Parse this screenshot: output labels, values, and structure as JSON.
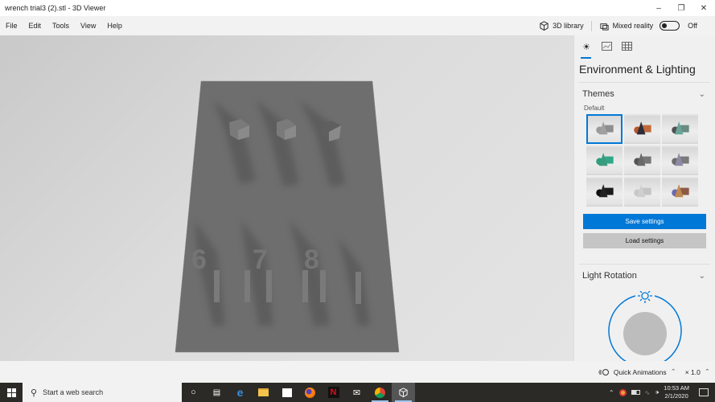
{
  "window": {
    "title": "wrench trial3 (2).stl - 3D Viewer",
    "controls": [
      "minimize",
      "restore",
      "close"
    ]
  },
  "menubar": {
    "items": [
      "File",
      "Edit",
      "Tools",
      "View",
      "Help"
    ],
    "library_label": "3D library",
    "mixed_reality_label": "Mixed reality",
    "mixed_reality_state": "Off",
    "mixed_reality_on": false
  },
  "viewport": {
    "model": "wrench holder plate",
    "labels_on_model": [
      "6",
      "7",
      "8"
    ]
  },
  "panel": {
    "tabs": [
      {
        "icon": "sun-icon",
        "active": true
      },
      {
        "icon": "stats-icon",
        "active": false
      },
      {
        "icon": "grid-icon",
        "active": false
      }
    ],
    "title": "Environment & Lighting",
    "themes": {
      "label": "Themes",
      "selected_label": "Default",
      "thumbnails": [
        {
          "name": "default",
          "colors": [
            "#9a9a9a",
            "#a0a0a0",
            "#8e8e8e"
          ],
          "selected": true
        },
        {
          "name": "copper",
          "colors": [
            "#b5562a",
            "#2c2c3a",
            "#c06a3a"
          ],
          "selected": false
        },
        {
          "name": "teal",
          "colors": [
            "#4f4f4f",
            "#68a59a",
            "#6a8a82"
          ],
          "selected": false
        },
        {
          "name": "green",
          "colors": [
            "#2aa07e",
            "#3a9b7d",
            "#31a788"
          ],
          "selected": false
        },
        {
          "name": "dark-gray",
          "colors": [
            "#555555",
            "#6a6a6a",
            "#777777"
          ],
          "selected": false
        },
        {
          "name": "lavender",
          "colors": [
            "#6c6c6c",
            "#8f8aa6",
            "#7a7a7a"
          ],
          "selected": false
        },
        {
          "name": "black",
          "colors": [
            "#111111",
            "#222222",
            "#1a1a1a"
          ],
          "selected": false
        },
        {
          "name": "light",
          "colors": [
            "#c8c8c8",
            "#cfcfcf",
            "#c4c4c4"
          ],
          "selected": false
        },
        {
          "name": "bronze",
          "colors": [
            "#6b6ab0",
            "#c08a4f",
            "#8c5a45"
          ],
          "selected": false
        }
      ]
    },
    "save_label": "Save settings",
    "load_label": "Load settings",
    "light_rotation_label": "Light Rotation",
    "accent": "#0078d7"
  },
  "bottombar": {
    "quick_animations_label": "Quick Animations",
    "speed_label": "× 1.0"
  },
  "taskbar": {
    "search_placeholder": "Start a web search",
    "apps": [
      "cortana",
      "task-view",
      "edge",
      "file-explorer",
      "store",
      "firefox",
      "netflix",
      "mail",
      "chrome",
      "3d-viewer"
    ],
    "time": "10:53 AM",
    "date": "2/1/2020"
  }
}
